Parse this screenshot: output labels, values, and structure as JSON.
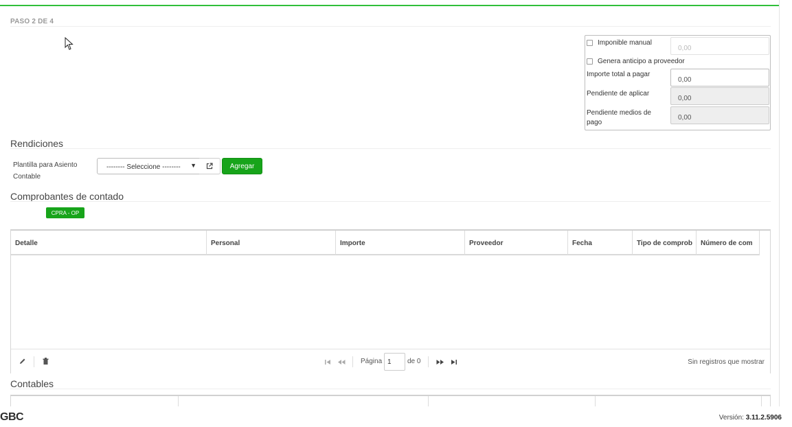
{
  "step": "PASO 2 DE 4",
  "summary": {
    "imponible_manual_label": "Imponible manual",
    "imponible_manual_value": "0,00",
    "anticipo_label": "Genera anticipo a proveedor",
    "importe_total_label": "Importe total a pagar",
    "importe_total_value": "0,00",
    "pendiente_aplicar_label": "Pendiente de aplicar",
    "pendiente_aplicar_value": "0,00",
    "pendiente_medios_label_line1": "Pendiente medios de",
    "pendiente_medios_label_line2": "pago",
    "pendiente_medios_value": "0,00"
  },
  "rendiciones": {
    "title": "Rendiciones",
    "plantilla_label_line1": "Plantilla para Asiento",
    "plantilla_label_line2": "Contable",
    "select_value": "-------- Seleccione --------",
    "add_button": "Agregar"
  },
  "comprobantes": {
    "title": "Comprobantes de contado",
    "tag": "CPRA - OP",
    "columns": [
      "Detalle",
      "Personal",
      "Importe",
      "Proveedor",
      "Fecha",
      "Tipo de comprob",
      "Número de com"
    ],
    "pager": {
      "page_label": "Página",
      "page_value": "1",
      "of_label": "de 0",
      "empty_text": "Sin registros que mostrar"
    }
  },
  "contables": {
    "title": "Contables"
  },
  "footer": {
    "logo": "GBC",
    "version_label": "Versión:",
    "version_value": "3.11.2.5906"
  }
}
